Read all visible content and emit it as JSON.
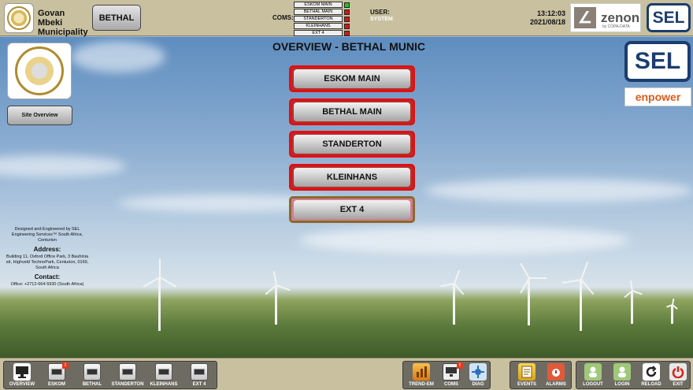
{
  "header": {
    "municipality_name": "Govan Mbeki Municipality",
    "site_button": "BETHAL",
    "coms_label": "COMS:",
    "coms": [
      {
        "name": "ESKOM MAIN",
        "status_color": "#22c21f"
      },
      {
        "name": "BETHAL MAIN",
        "status_color": "#d01a1a"
      },
      {
        "name": "STANDERTON",
        "status_color": "#d01a1a"
      },
      {
        "name": "KLEINHANS",
        "status_color": "#d01a1a"
      },
      {
        "name": "EXT 4",
        "status_color": "#d01a1a"
      }
    ],
    "user_label": "USER:",
    "user_value": "SYSTEM",
    "time": "13:12:03",
    "date": "2021/08/18",
    "zenon_brand": "zenon",
    "zenon_sub": "by COPA-DATA",
    "sel_brand": "SEL"
  },
  "main": {
    "title": "OVERVIEW - BETHAL MUNIC",
    "site_overview_button": "Site Overview",
    "nav_buttons": [
      {
        "label": "ESKOM MAIN"
      },
      {
        "label": "BETHAL MAIN"
      },
      {
        "label": "STANDERTON"
      },
      {
        "label": "KLEINHANS"
      },
      {
        "label": "EXT 4"
      }
    ],
    "sel_brand": "SEL",
    "enpower_brand": "enpower",
    "info": {
      "designed_by": "Designed and Engineered by SEL Engineering Services™ South Africa, Centurion",
      "address_heading": "Address:",
      "address": "Building 11, Oxford Office Park, 3 Bauhinia str, Highveld TechnoPark, Centurion, 0169, South Africa",
      "contact_heading": "Contact:",
      "contact": "Office: +2712-664-5930 (South Africa)"
    }
  },
  "footer": {
    "nav_group": [
      {
        "label": "OVERVIEW",
        "icon": "monitor-icon",
        "alert": ""
      },
      {
        "label": "ESKOM",
        "icon": "meter-icon",
        "alert": "!"
      },
      {
        "label": "BETHAL",
        "icon": "meter-icon",
        "alert": ""
      },
      {
        "label": "STANDERTON",
        "icon": "meter-icon",
        "alert": ""
      },
      {
        "label": "KLEINHANS",
        "icon": "meter-icon",
        "alert": ""
      },
      {
        "label": "EXT 4",
        "icon": "meter-icon",
        "alert": ""
      }
    ],
    "tools_group": [
      {
        "label": "TREND-EM",
        "icon": "trend-icon",
        "alert": ""
      },
      {
        "label": "COMS",
        "icon": "network-icon",
        "alert": "!"
      },
      {
        "label": "DIAG",
        "icon": "diagnostics-icon",
        "alert": ""
      }
    ],
    "alarm_group": [
      {
        "label": "EVENTS",
        "icon": "events-icon",
        "alert": ""
      },
      {
        "label": "ALARMS",
        "icon": "alarm-icon",
        "alert": ""
      }
    ],
    "session_group": [
      {
        "label": "LOGOUT",
        "icon": "logout-icon",
        "alert": ""
      },
      {
        "label": "LOGIN",
        "icon": "login-icon",
        "alert": ""
      },
      {
        "label": "RELOAD",
        "icon": "reload-icon",
        "alert": ""
      },
      {
        "label": "EXIT",
        "icon": "power-icon",
        "alert": ""
      }
    ]
  }
}
